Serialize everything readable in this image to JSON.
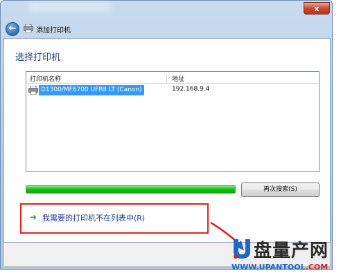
{
  "window": {
    "title": "添加打印机",
    "close_label": "x"
  },
  "page": {
    "heading": "选择打印机"
  },
  "printer_list": {
    "columns": [
      "打印机名称",
      "地址"
    ],
    "rows": [
      {
        "name": "D1300/MF6700 UFRII LT (Canon)",
        "address": "192.168.9.4",
        "selected": true
      }
    ]
  },
  "search": {
    "progress_fraction": 1.0,
    "search_again_label": "再次搜索(S)"
  },
  "not_listed": {
    "link_label": "我需要的打印机不在列表中(R)"
  },
  "watermark": {
    "cn_text": "盘量产网",
    "url_prefix": "WWW.UPANTOOL",
    "url_suffix": ".COM"
  },
  "colors": {
    "selection": "#3399ff",
    "progress": "#17c11a",
    "highlight_box": "#e02020",
    "heading": "#1e3e87"
  }
}
